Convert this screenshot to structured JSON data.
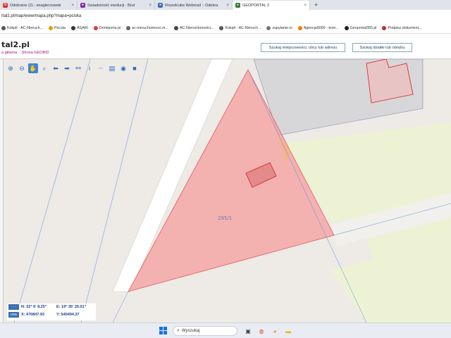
{
  "tabs": [
    {
      "title": "Odebrane (2) - anaglerzowski",
      "favicon": "gmail-icon",
      "color": "#d93025",
      "glyph": "M"
    },
    {
      "title": "Świadomość ewolucji - Brut",
      "favicon": "podcast-icon",
      "color": "#8e24aa",
      "glyph": "●"
    },
    {
      "title": "Roundcube Webmail :: Odebra",
      "favicon": "roundcube-icon",
      "color": "#3c6db3",
      "glyph": "●"
    },
    {
      "title": "GEOPORTAL 2",
      "favicon": "geoportal-icon",
      "color": "#2e7d32",
      "glyph": "●",
      "active": true
    }
  ],
  "new_tab_label": "+",
  "close_glyph": "×",
  "address": {
    "url": "rtal2.pl/map/www/mapa.php?mapa=pciska"
  },
  "bookmarks": [
    {
      "label": "Kokpit - AC-Nieruch...",
      "color": "#555"
    },
    {
      "label": "Poczta",
      "color": "#e0a000"
    },
    {
      "label": "ASARI",
      "color": "#333"
    },
    {
      "label": "Domiporta.pl",
      "color": "#e53935"
    },
    {
      "label": "ac-nieruchomosci.m...",
      "color": "#666"
    },
    {
      "label": "AC-Nieruchomości...",
      "color": "#444"
    },
    {
      "label": "Kokpit - AC-Nieruch...",
      "color": "#555"
    },
    {
      "label": "zapytanie.io",
      "color": "#777"
    },
    {
      "label": "Agencja5000 - kom...",
      "color": "#f57c00"
    },
    {
      "label": "Geoportal360.pl",
      "color": "#222"
    },
    {
      "label": "Podpisz dokument...",
      "color": "#c62828"
    }
  ],
  "site": {
    "logo": "tal2.pl",
    "links": [
      "a główna",
      "Strona GEOBID"
    ],
    "search_address_button": "Szukaj miejscowości, ulicy lub adresu",
    "search_parcel_button": "Szukaj działki lub obrębu"
  },
  "toolbar": [
    {
      "name": "zoom-in-icon",
      "glyph": "⊕",
      "selected": false
    },
    {
      "name": "zoom-out-icon",
      "glyph": "⊖",
      "selected": false
    },
    {
      "name": "pan-hand-icon",
      "glyph": "✋",
      "selected": true
    },
    {
      "name": "zoom-box-icon",
      "glyph": "⌕",
      "selected": false
    },
    {
      "name": "back-arrow-icon",
      "glyph": "⬅",
      "selected": false
    },
    {
      "name": "forward-arrow-icon",
      "glyph": "➡",
      "selected": false
    },
    {
      "name": "link-icon",
      "glyph": "⚯",
      "selected": false
    },
    {
      "name": "info-icon",
      "glyph": "i",
      "selected": false
    },
    {
      "name": "measure-icon",
      "glyph": "┈",
      "selected": false
    },
    {
      "name": "print-icon",
      "glyph": "▤",
      "selected": false
    },
    {
      "name": "globe-icon",
      "glyph": "◉",
      "selected": false
    },
    {
      "name": "camera-icon",
      "glyph": "■",
      "selected": false
    }
  ],
  "map": {
    "parcel_label": "295/1",
    "colors": {
      "parcel_fill": "#f4a3a3",
      "parcel_stroke": "#e25b5b",
      "building_stroke": "#d42020",
      "green": "#eef2d4",
      "grey": "#d7d7d9",
      "road": "#f2f0ec"
    }
  },
  "coords": {
    "box1": "- - -",
    "box2": "1992",
    "n": "N:  52° 6' 8.25\"",
    "e": "E:  19° 35' 29.01\"",
    "x": "X:  470847.93",
    "y": "Y:  540494.37"
  },
  "taskbar": {
    "search_placeholder": "Wyszukaj",
    "apps": [
      {
        "name": "task-view-icon",
        "color": "#444",
        "glyph": "▣"
      },
      {
        "name": "chrome-icon",
        "color": "#e8453c",
        "glyph": "◍"
      },
      {
        "name": "firefox-icon",
        "color": "#ff7a1a",
        "glyph": "◕"
      },
      {
        "name": "file-explorer-icon",
        "color": "#f2b600",
        "glyph": "▬"
      }
    ]
  }
}
